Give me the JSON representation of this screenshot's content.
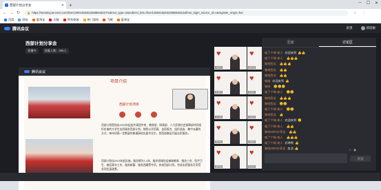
{
  "browser": {
    "tab_title": "西部计划分享会",
    "url": "https://meeting.tencent.com/live/12984155452388864522?redirect_type=2&redirect_link=/live/12984155452388864522&from_login_source_id=1&register_origin=live",
    "bookmarks": [
      {
        "label": "百度",
        "color": "#2b6fe8"
      },
      {
        "label": "网址",
        "color": "#3aa0ff"
      },
      {
        "label": "爱淘宝",
        "color": "#ff6a00"
      },
      {
        "label": "天猫",
        "color": "#e0182c"
      },
      {
        "label": "京东商城",
        "color": "#e1251b"
      },
      {
        "label": "热门游戏",
        "color": "#f5a623"
      },
      {
        "label": "飞猪",
        "color": "#ff5000"
      },
      {
        "label": "爱淘宝",
        "color": "#ff6a00"
      }
    ]
  },
  "app": {
    "brand": "腾讯会议",
    "header_actions": [
      "反馈",
      "郑思敏"
    ]
  },
  "meeting": {
    "title": "西部计划分享会",
    "status_badge": "直播中",
    "viewers": "观看人数：595人"
  },
  "video": {
    "brand": "腾讯会议",
    "slide_title": "项目介绍",
    "slide_subtitle": "西部计划项目",
    "para1": "西部计划是指自2003年起由共青团中央、教育部、财政部、人力资源社会保障部共同组织实施的大学生志愿服务西部计划，按照公开招募、自愿报名、组织选拔、集中派遣的方式，每年招募一定数量的普通高校应届毕业生，到西部基层开展志愿服务。",
    "para2": "西部计划自2003年起实施，服务期为1-3年，服务领域包括基础教育、服务三农、医疗卫生、基层青年工作、服务新疆、服务西藏等专项，参加西部计划，完成志愿服务可享受多项优惠政策。"
  },
  "thumbnails": [
    {
      "name": "冯燕清"
    },
    {
      "name": "姚晓蕾"
    },
    {
      "name": "朱惠芳"
    },
    {
      "name": "何丽莎"
    },
    {
      "name": "卓文静"
    },
    {
      "name": "周思颖"
    },
    {
      "name": "黄欣怡"
    },
    {
      "name": "林雅婷"
    },
    {
      "name": "郑晓敏"
    },
    {
      "name": "陈佳慧"
    }
  ],
  "panel": {
    "tabs": [
      "互动",
      "讨论区"
    ],
    "messages": [
      {
        "name": "喵了个咪-来人",
        "text": "欢迎来到",
        "emoji": "👍👍"
      },
      {
        "name": "喵了个咪-来人",
        "text": "",
        "emoji": "👍👍👍"
      },
      {
        "name": "咖啡西瓜",
        "text": "",
        "emoji": "👍👍👍"
      },
      {
        "name": "咖啡西瓜",
        "text": "",
        "emoji": "👍👍"
      },
      {
        "name": "咖啡西瓜",
        "text": "",
        "emoji": "👍👍"
      },
      {
        "name": "喵喵",
        "text": "欢迎来到",
        "emoji": "👍"
      },
      {
        "name": "咖啡",
        "text": "",
        "emoji": "😊😊😊"
      },
      {
        "name": "喵了个咪-来人",
        "text": "",
        "emoji": "😊😊"
      },
      {
        "name": "咖啡西瓜",
        "text": "",
        "emoji": "👍👍👍"
      },
      {
        "name": "咖啡西瓜",
        "text": "",
        "emoji": "😊😊"
      },
      {
        "name": "喵了个咪-来人",
        "text": "",
        "emoji": "😊😊"
      },
      {
        "name": "咖啡西瓜",
        "text": "",
        "emoji": "👍"
      },
      {
        "name": "喵了个咪-来人",
        "text": "欢迎来到",
        "emoji": "😊"
      },
      {
        "name": "喵了个咪-来人",
        "text": "",
        "emoji": "👍👍"
      },
      {
        "name": "咖啡2000分享会",
        "text": "",
        "emoji": "👍👍"
      },
      {
        "name": "喵了个咪-来人",
        "text": "",
        "emoji": "👍👍👍"
      },
      {
        "name": "喵了个咪-来人",
        "text": "好棒啊",
        "emoji": "👍"
      },
      {
        "name": "咖啡2000分享会",
        "text": "加油",
        "emoji": "👍"
      }
    ],
    "send_label": "发送"
  }
}
